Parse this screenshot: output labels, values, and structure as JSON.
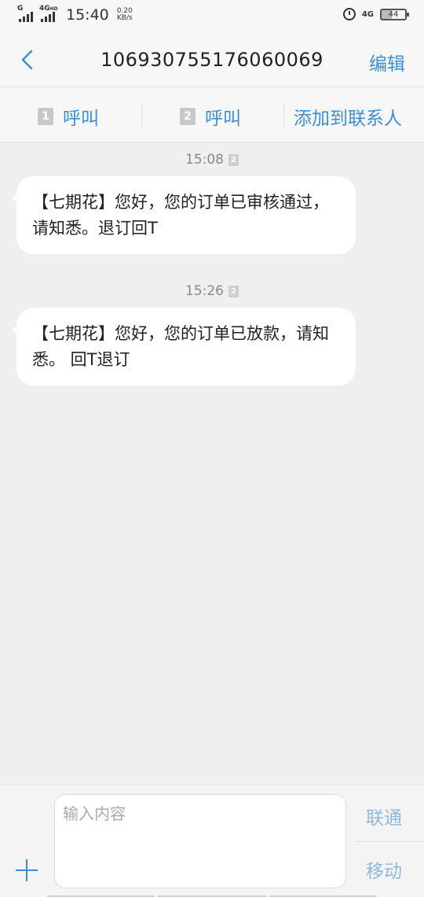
{
  "status_bar": {
    "sim1_label": "G",
    "sim2_label": "4G",
    "sim2_sub": "HD",
    "time": "15:40",
    "speed_value": "0.20",
    "speed_unit": "KB/s",
    "net_label": "4G",
    "battery": "44"
  },
  "header": {
    "title": "106930755176060069",
    "edit_label": "编辑"
  },
  "actions": {
    "call1_sim": "1",
    "call1_label": "呼叫",
    "call2_sim": "2",
    "call2_label": "呼叫",
    "add_contact_label": "添加到联系人"
  },
  "messages": [
    {
      "time": "15:08",
      "sim": "2",
      "text": "【七期花】您好，您的订单已审核通过，请知悉。退订回T"
    },
    {
      "time": "15:26",
      "sim": "2",
      "text": "【七期花】您好，您的订单已放款，请知悉。 回T退订"
    }
  ],
  "composer": {
    "placeholder": "输入内容",
    "send_carrier1": "联通",
    "send_carrier2": "移动"
  },
  "colors": {
    "accent": "#3a8fd8",
    "send_disabled": "#8fb8de",
    "background": "#efefef",
    "bubble": "#ffffff"
  }
}
